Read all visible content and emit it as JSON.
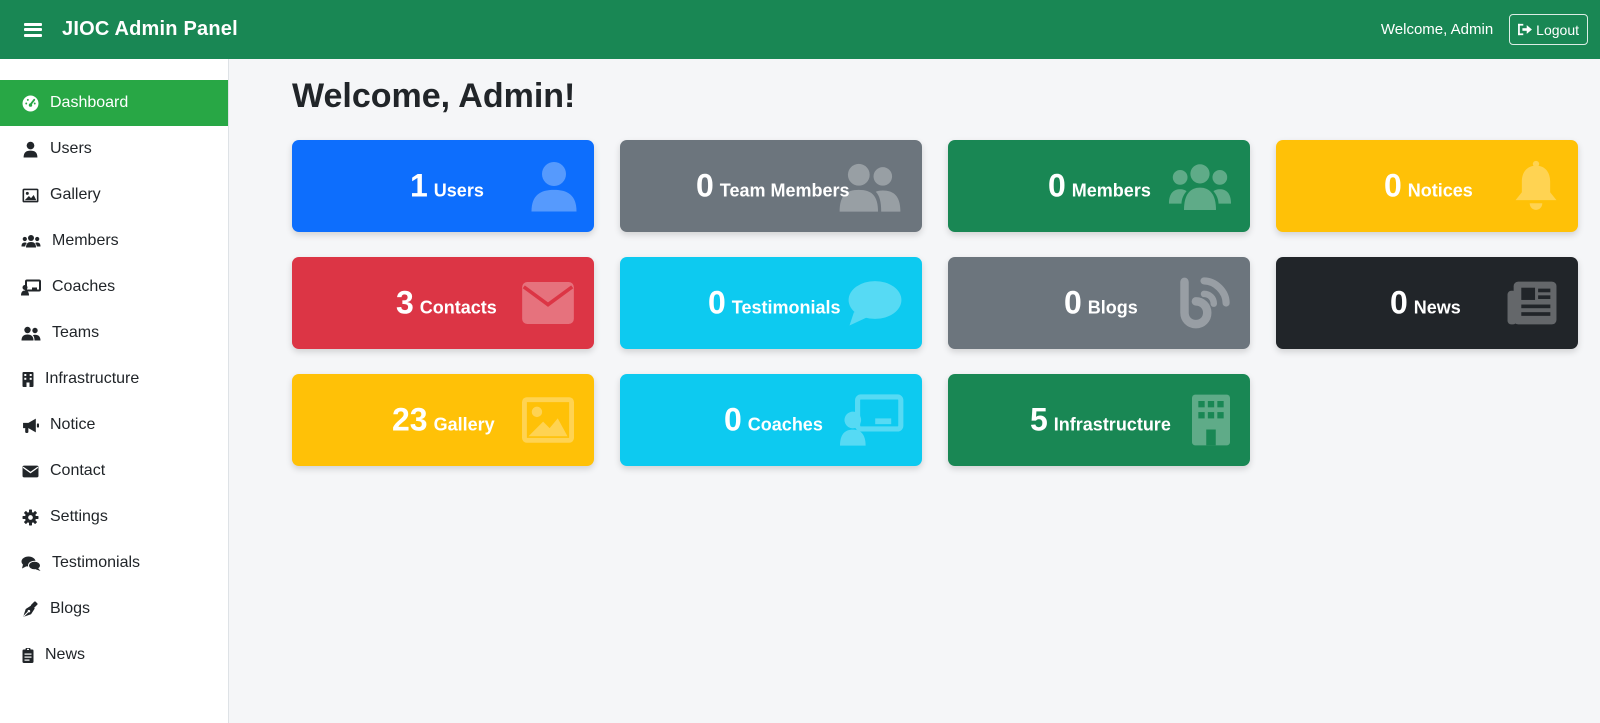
{
  "navbar": {
    "brand": "JIOC Admin Panel",
    "welcome": "Welcome, Admin",
    "logout_label": "Logout"
  },
  "sidebar": {
    "items": [
      {
        "label": "Dashboard",
        "icon": "gauge-icon"
      },
      {
        "label": "Users",
        "icon": "user-icon"
      },
      {
        "label": "Gallery",
        "icon": "image-icon"
      },
      {
        "label": "Members",
        "icon": "users-icon"
      },
      {
        "label": "Coaches",
        "icon": "chalkboard-user-icon"
      },
      {
        "label": "Teams",
        "icon": "user-group-icon"
      },
      {
        "label": "Infrastructure",
        "icon": "building-icon"
      },
      {
        "label": "Notice",
        "icon": "bullhorn-icon"
      },
      {
        "label": "Contact",
        "icon": "envelope-icon"
      },
      {
        "label": "Settings",
        "icon": "cog-icon"
      },
      {
        "label": "Testimonials",
        "icon": "comments-icon"
      },
      {
        "label": "Blogs",
        "icon": "pen-nib-icon"
      },
      {
        "label": "News",
        "icon": "clipboard-icon"
      }
    ]
  },
  "main": {
    "title": "Welcome, Admin!",
    "cards": [
      {
        "count": "1",
        "label": "Users",
        "color": "#0d6efd",
        "icon": "user-icon"
      },
      {
        "count": "0",
        "label": "Team Members",
        "color": "#6c757d",
        "icon": "user-group-icon"
      },
      {
        "count": "0",
        "label": "Members",
        "color": "#198754",
        "icon": "users-icon"
      },
      {
        "count": "0",
        "label": "Notices",
        "color": "#ffc107",
        "icon": "bell-icon"
      },
      {
        "count": "3",
        "label": "Contacts",
        "color": "#dc3545",
        "icon": "envelope-icon"
      },
      {
        "count": "0",
        "label": "Testimonials",
        "color": "#0dcaf0",
        "icon": "comment-icon"
      },
      {
        "count": "0",
        "label": "Blogs",
        "color": "#6c757d",
        "icon": "blog-icon"
      },
      {
        "count": "0",
        "label": "News",
        "color": "#212529",
        "icon": "newspaper-icon"
      },
      {
        "count": "23",
        "label": "Gallery",
        "color": "#ffc107",
        "icon": "image-icon"
      },
      {
        "count": "0",
        "label": "Coaches",
        "color": "#0dcaf0",
        "icon": "chalkboard-user-icon"
      },
      {
        "count": "5",
        "label": "Infrastructure",
        "color": "#198754",
        "icon": "building-icon"
      }
    ]
  },
  "colors": {
    "navbar": "#198754",
    "sidebar_active": "#28a745",
    "page_background": "#f5f6f8"
  }
}
